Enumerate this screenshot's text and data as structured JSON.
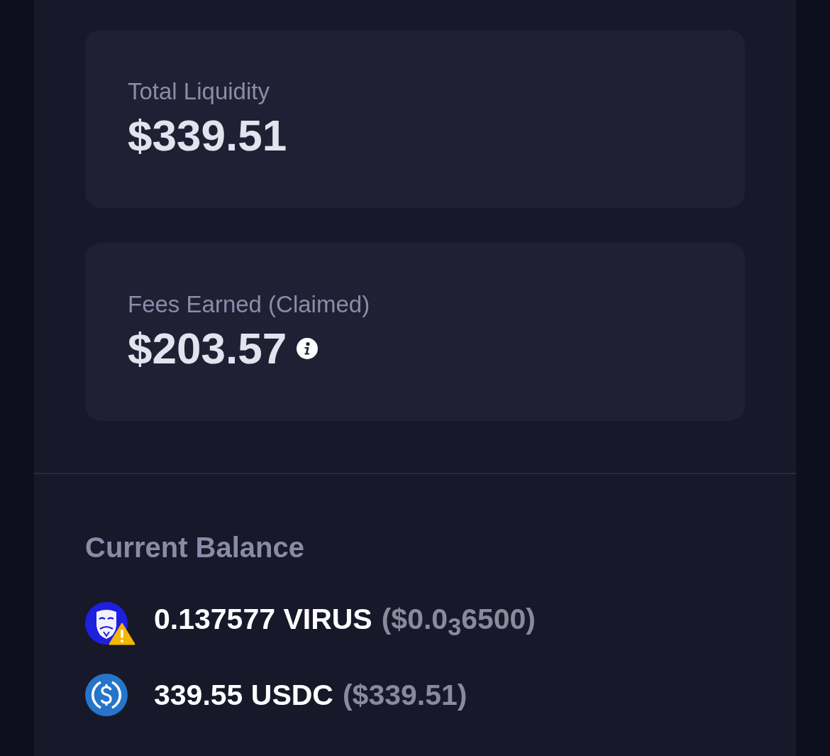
{
  "cards": [
    {
      "label": "Total Liquidity",
      "value": "$339.51",
      "info": false
    },
    {
      "label": "Fees Earned (Claimed)",
      "value": "$203.57",
      "info": true
    }
  ],
  "balance": {
    "title": "Current Balance",
    "tokens": [
      {
        "kind": "mask",
        "amount": "0.137577 VIRUS",
        "usd": "($0.0$_{3}$6500)",
        "warning": true
      },
      {
        "kind": "usdc",
        "amount": "339.55 USDC",
        "usd": "($339.51)",
        "warning": false
      }
    ]
  }
}
